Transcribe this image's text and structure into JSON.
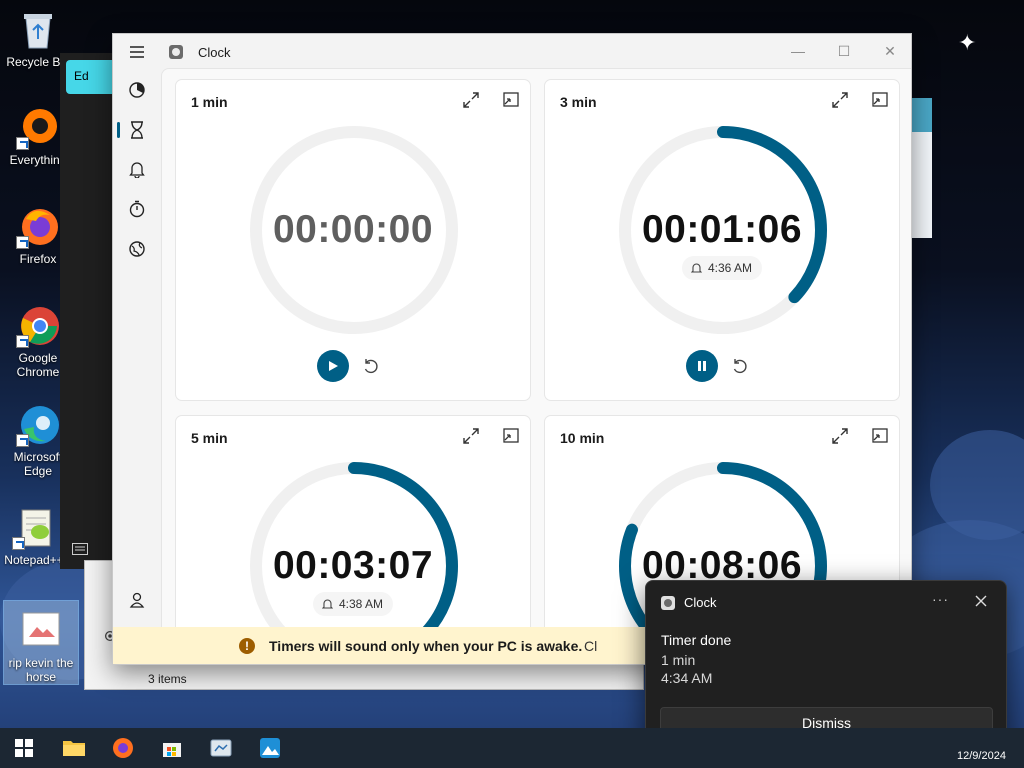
{
  "desktop": {
    "icons": [
      {
        "label": "Recycle Bin",
        "icon": "recycle-bin-icon"
      },
      {
        "label": "Everything",
        "icon": "everything-icon"
      },
      {
        "label": "Firefox",
        "icon": "firefox-icon"
      },
      {
        "label": "Google Chrome",
        "icon": "chrome-icon"
      },
      {
        "label": "Microsoft Edge",
        "icon": "edge-icon"
      },
      {
        "label": "Notepad++",
        "icon": "notepadpp-icon"
      },
      {
        "label": "rip kevin the horse",
        "icon": "image-file-icon"
      }
    ],
    "bg_window_tab": "Ed",
    "bg_window_status": "3 items"
  },
  "clock": {
    "title": "Clock",
    "nav": [
      "focus-sessions-icon",
      "timer-icon",
      "alarm-icon",
      "stopwatch-icon",
      "world-clock-icon"
    ],
    "timers": [
      {
        "title": "1 min",
        "time": "00:00:00",
        "alarm": "",
        "state": "idle",
        "progress": 0
      },
      {
        "title": "3 min",
        "time": "00:01:06",
        "alarm": "4:36 AM",
        "state": "running",
        "progress": 0.37
      },
      {
        "title": "5 min",
        "time": "00:03:07",
        "alarm": "4:38 AM",
        "state": "paused",
        "progress": 0.62
      },
      {
        "title": "10 min",
        "time": "00:08:06",
        "alarm": "",
        "state": "paused",
        "progress": 0.81
      }
    ],
    "banner_text": "Timers will sound only when your PC is awake.",
    "banner_close": "Cl"
  },
  "toast": {
    "app": "Clock",
    "more": "···",
    "heading": "Timer done",
    "line1": "1 min",
    "line2": "4:34 AM",
    "dismiss": "Dismiss"
  },
  "taskbar": {
    "apps": [
      "windows-start-icon",
      "file-explorer-icon",
      "firefox-icon",
      "microsoft-store-icon",
      "clock-app-icon",
      "photos-icon"
    ],
    "date": "12/9/2024"
  },
  "colors": {
    "accent": "#005f86",
    "ring_track": "#f0f0f0",
    "banner": "#fff4ce",
    "toast_bg": "#202020"
  }
}
